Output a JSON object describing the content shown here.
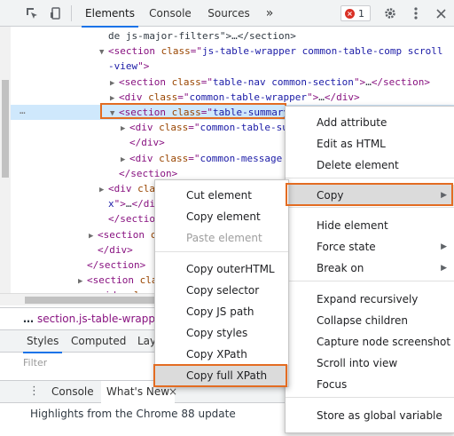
{
  "toolbar": {
    "tabs": [
      "Elements",
      "Console",
      "Sources"
    ],
    "more": "»",
    "error_count": "1"
  },
  "tree": {
    "rows": [
      {
        "indent": 1,
        "twisty": "",
        "html": [
          [
            "tx",
            "de js-major-filters\">…</section>"
          ]
        ]
      },
      {
        "indent": 1,
        "twisty": "▼",
        "html": [
          [
            "tag",
            "<section "
          ],
          [
            "an",
            "class"
          ],
          [
            "tag",
            "=\""
          ],
          [
            "av",
            "js-table-wrapper common-table-comp scroll"
          ]
        ]
      },
      {
        "indent": 1,
        "twisty": "",
        "html": [
          [
            "av",
            "-view"
          ],
          [
            "tag",
            "\">"
          ]
        ]
      },
      {
        "indent": 2,
        "twisty": "▶",
        "html": [
          [
            "tag",
            "<section "
          ],
          [
            "an",
            "class"
          ],
          [
            "tag",
            "=\""
          ],
          [
            "av",
            "table-nav common-section"
          ],
          [
            "tag",
            "\">"
          ],
          [
            "tx",
            "…"
          ],
          [
            "tag",
            "</section>"
          ]
        ]
      },
      {
        "indent": 2,
        "twisty": "▶",
        "html": [
          [
            "tag",
            "<div "
          ],
          [
            "an",
            "class"
          ],
          [
            "tag",
            "=\""
          ],
          [
            "av",
            "common-table-wrapper"
          ],
          [
            "tag",
            "\">"
          ],
          [
            "tx",
            "…"
          ],
          [
            "tag",
            "</div>"
          ]
        ]
      },
      {
        "indent": 2,
        "twisty": "▼",
        "html": [
          [
            "tag",
            "<section "
          ],
          [
            "an",
            "class"
          ],
          [
            "tag",
            "=\""
          ],
          [
            "av",
            "table-summary"
          ],
          [
            "tag",
            "\">"
          ]
        ]
      },
      {
        "indent": 3,
        "twisty": "▶",
        "html": [
          [
            "tag",
            "<div "
          ],
          [
            "an",
            "class"
          ],
          [
            "tag",
            "=\""
          ],
          [
            "av",
            "common-table-summ"
          ]
        ]
      },
      {
        "indent": 3,
        "twisty": "",
        "html": [
          [
            "tag",
            "</div>"
          ]
        ]
      },
      {
        "indent": 3,
        "twisty": "▶",
        "html": [
          [
            "tag",
            "<div "
          ],
          [
            "an",
            "class"
          ],
          [
            "tag",
            "=\""
          ],
          [
            "av",
            "common-message em"
          ]
        ]
      },
      {
        "indent": 2,
        "twisty": "",
        "html": [
          [
            "tag",
            "</section>"
          ]
        ]
      },
      {
        "indent": 1,
        "twisty": "▶",
        "html": [
          [
            "tag",
            "<div "
          ],
          [
            "an",
            "clas"
          ]
        ]
      },
      {
        "indent": 1,
        "twisty": "",
        "html": [
          [
            "av",
            "x"
          ],
          [
            "tag",
            "\">"
          ],
          [
            "tx",
            "…"
          ],
          [
            "tag",
            "</div>"
          ]
        ]
      },
      {
        "indent": 1,
        "twisty": "",
        "html": [
          [
            "tag",
            "</section>"
          ]
        ]
      },
      {
        "indent": 0,
        "twisty": "▶",
        "html": [
          [
            "tag",
            "<section "
          ],
          [
            "an",
            "c"
          ]
        ]
      },
      {
        "indent": 0,
        "twisty": "",
        "html": [
          [
            "tag",
            "</div>"
          ]
        ]
      },
      {
        "indent": -1,
        "twisty": "",
        "html": [
          [
            "tag",
            "</section>"
          ]
        ]
      },
      {
        "indent": -1,
        "twisty": "▶",
        "html": [
          [
            "tag",
            "<section "
          ],
          [
            "an",
            "class"
          ]
        ]
      },
      {
        "indent": -1,
        "twisty": "▶",
        "html": [
          [
            "tag",
            "<aside "
          ],
          [
            "an",
            "class"
          ],
          [
            "tag",
            "=\""
          ]
        ]
      }
    ],
    "selected_row": 5,
    "ellipsis": "…"
  },
  "breadcrumb": {
    "ellipsis": "…",
    "path": "section.js-table-wrapper."
  },
  "subtabs": [
    "Styles",
    "Computed",
    "Lay"
  ],
  "filter_placeholder": "Filter",
  "drawer": {
    "menu_icon": "⋮",
    "tabs": [
      "Console",
      "What's New"
    ],
    "close": "×",
    "highlights": "Highlights from the Chrome 88 update"
  },
  "context_menu": {
    "items": [
      "Add attribute",
      "Edit as HTML",
      "Delete element",
      "Copy",
      "Hide element",
      "Force state",
      "Break on",
      "Expand recursively",
      "Collapse children",
      "Capture node screenshot",
      "Scroll into view",
      "Focus",
      "Store as global variable"
    ],
    "submenu_items": [
      "Copy"
    ]
  },
  "copy_submenu": {
    "items": [
      "Cut element",
      "Copy element",
      "Paste element",
      "Copy outerHTML",
      "Copy selector",
      "Copy JS path",
      "Copy styles",
      "Copy XPath",
      "Copy full XPath"
    ],
    "disabled": [
      "Paste element"
    ],
    "highlighted": "Copy full XPath"
  },
  "colors": {
    "highlight_outline": "#e36c22",
    "selected_row_bg": "#cfe8fc",
    "menu_hover_bg": "#dbdbdb",
    "accent": "#1a73e8"
  }
}
